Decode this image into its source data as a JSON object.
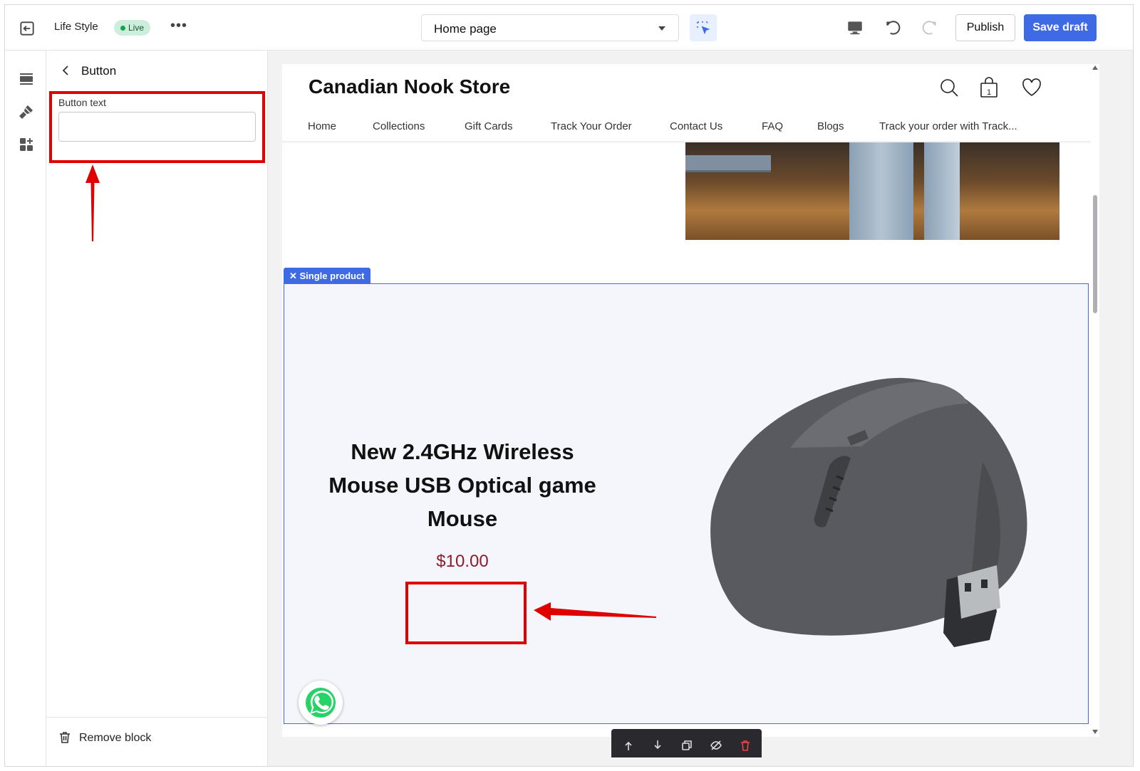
{
  "topbar": {
    "theme_name": "Life Style",
    "status_badge": "Live",
    "page_select_value": "Home page",
    "publish_label": "Publish",
    "save_draft_label": "Save draft"
  },
  "panel": {
    "title": "Button",
    "field_label": "Button text",
    "field_value": "",
    "remove_block_label": "Remove block"
  },
  "store": {
    "name": "Canadian Nook Store",
    "cart_count": "1",
    "nav": [
      "Home",
      "Collections",
      "Gift Cards",
      "Track Your Order",
      "Contact Us",
      "FAQ",
      "Blogs",
      "Track your order with Track..."
    ]
  },
  "section": {
    "tag_label": "Single product",
    "product_title": "New 2.4GHz Wireless Mouse USB Optical game Mouse",
    "product_price": "$10.00"
  },
  "colors": {
    "accent": "#3f6ae6",
    "annotation_red": "#e00000",
    "price": "#8b1d2c",
    "live_badge_bg": "#cdeedd"
  }
}
